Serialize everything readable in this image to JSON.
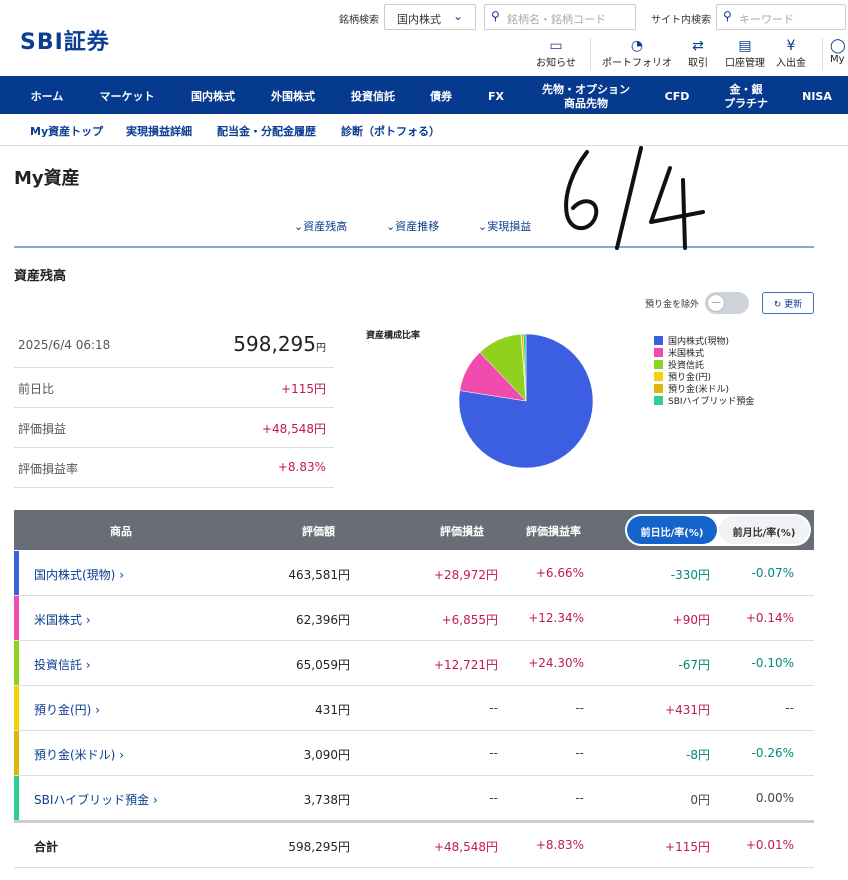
{
  "header": {
    "logo": "SBI証券",
    "stock_search_label": "銘柄検索",
    "market_select": "国内株式",
    "stock_placeholder": "銘柄名・銘柄コード",
    "site_search_label": "サイト内検索",
    "site_placeholder": "キーワード",
    "utils": [
      {
        "label": "お知らせ",
        "icon": "message-icon"
      },
      {
        "label": "ポートフォリオ",
        "icon": "portfolio-icon"
      },
      {
        "label": "取引",
        "icon": "trade-arrows-icon"
      },
      {
        "label": "口座管理",
        "icon": "account-icon"
      },
      {
        "label": "入出金",
        "icon": "yen-coin-icon"
      },
      {
        "label": "My",
        "icon": "user-icon"
      }
    ]
  },
  "nav": [
    "ホーム",
    "マーケット",
    "国内株式",
    "外国株式",
    "投資信託",
    "債券",
    "FX",
    "先物・オプション\n商品先物",
    "CFD",
    "金・銀\nプラチナ",
    "NISA"
  ],
  "subnav": [
    "My資産トップ",
    "実現損益詳細",
    "配当金・分配金履歴",
    "診断（ポトフォる）"
  ],
  "page_title": "My資産",
  "anchors": [
    "資産残高",
    "資産推移",
    "実現損益"
  ],
  "handwritten_note": "6/4",
  "section_title": "資産残高",
  "toggle_label": "預り金を除外",
  "refresh_label": "更新",
  "summary": {
    "datetime": "2025/6/4 06:18",
    "total": "598,295",
    "yen": "円",
    "rows": [
      {
        "label": "前日比",
        "value": "+115円"
      },
      {
        "label": "評価損益",
        "value": "+48,548円"
      },
      {
        "label": "評価損益率",
        "value": "+8.83%"
      }
    ]
  },
  "pie": {
    "title": "資産構成比率",
    "colors": [
      "#3b5fe0",
      "#f24bb0",
      "#8fd11e",
      "#f4d20a",
      "#d8b80a",
      "#2ed08c"
    ],
    "values": [
      463581,
      62396,
      65059,
      431,
      3090,
      3738
    ],
    "legend": [
      "国内株式(現物)",
      "米国株式",
      "投資信託",
      "預り金(円)",
      "預り金(米ドル)",
      "SBIハイブリッド預金"
    ]
  },
  "table": {
    "headers": {
      "product": "商品",
      "value": "評価額",
      "pl": "評価損益",
      "pl_rate": "評価損益率"
    },
    "tabs": {
      "active": "前日比/率(%)",
      "inactive": "前月比/率(%)"
    },
    "rows": [
      {
        "name": "国内株式(現物)",
        "color": "#3b5fe0",
        "value": "463,581円",
        "pl": "+28,972円",
        "pl_rate": "+6.66%",
        "dd": "-330円",
        "dd_rate": "-0.07%"
      },
      {
        "name": "米国株式",
        "color": "#f24bb0",
        "value": "62,396円",
        "pl": "+6,855円",
        "pl_rate": "+12.34%",
        "dd": "+90円",
        "dd_rate": "+0.14%"
      },
      {
        "name": "投資信託",
        "color": "#8fd11e",
        "value": "65,059円",
        "pl": "+12,721円",
        "pl_rate": "+24.30%",
        "dd": "-67円",
        "dd_rate": "-0.10%"
      },
      {
        "name": "預り金(円)",
        "color": "#f4d20a",
        "value": "431円",
        "pl": "--",
        "pl_rate": "--",
        "dd": "+431円",
        "dd_rate": "--"
      },
      {
        "name": "預り金(米ドル)",
        "color": "#d8b80a",
        "value": "3,090円",
        "pl": "--",
        "pl_rate": "--",
        "dd": "-8円",
        "dd_rate": "-0.26%"
      },
      {
        "name": "SBIハイブリッド預金",
        "color": "#2ed08c",
        "value": "3,738円",
        "pl": "--",
        "pl_rate": "--",
        "dd": "0円",
        "dd_rate": "0.00%"
      }
    ],
    "total": {
      "name": "合計",
      "value": "598,295円",
      "pl": "+48,548円",
      "pl_rate": "+8.83%",
      "dd": "+115円",
      "dd_rate": "+0.01%"
    }
  }
}
